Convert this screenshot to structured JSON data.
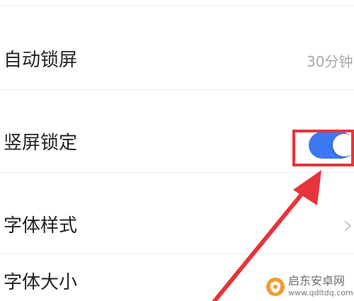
{
  "settings": {
    "rows": [
      {
        "label": "自动锁屏",
        "value": "30分钟"
      },
      {
        "label": "竖屏锁定",
        "toggle": "on"
      },
      {
        "label": "字体样式"
      },
      {
        "label": "字体大小"
      }
    ]
  },
  "colors": {
    "toggle_on": "#3b78f1",
    "annotation_red": "#e8343c"
  },
  "icons": {
    "chevron": "chevron-right-icon",
    "watermark_logo": "orange-shield-logo-icon"
  },
  "watermark": {
    "title": "启东安卓网",
    "url": "www.qdltdq.com"
  }
}
